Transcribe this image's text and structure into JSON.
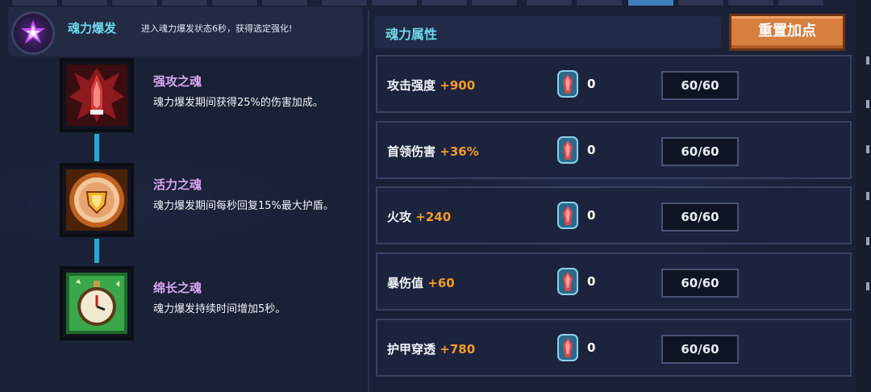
{
  "skill": {
    "name": "魂力爆发",
    "description": "进入魂力爆发状态6秒，获得选定强化!"
  },
  "souls": [
    {
      "name": "强攻之魂",
      "description": "魂力爆发期间获得25%的伤害加成。",
      "icon": "red-attack-soul-icon"
    },
    {
      "name": "活力之魂",
      "description": "魂力爆发期间每秒回复15%最大护盾。",
      "icon": "gold-shield-soul-icon"
    },
    {
      "name": "绵长之魂",
      "description": "魂力爆发持续时间增加5秒。",
      "icon": "green-clock-soul-icon"
    }
  ],
  "attributes": {
    "title": "魂力属性",
    "reset_label": "重置加点",
    "rows": [
      {
        "name": "攻击强度",
        "bonus": "+900",
        "gems": "0",
        "level": "60/60"
      },
      {
        "name": "首领伤害",
        "bonus": "+36%",
        "gems": "0",
        "level": "60/60"
      },
      {
        "name": "火攻",
        "bonus": "+240",
        "gems": "0",
        "level": "60/60"
      },
      {
        "name": "暴伤值",
        "bonus": "+60",
        "gems": "0",
        "level": "60/60"
      },
      {
        "name": "护甲穿透",
        "bonus": "+780",
        "gems": "0",
        "level": "60/60"
      }
    ]
  },
  "colors": {
    "accent_cyan": "#6fd8ea",
    "soul_name": "#d8a8f2",
    "bonus_orange": "#f59a2a",
    "reset_button": "#d67f3f"
  }
}
